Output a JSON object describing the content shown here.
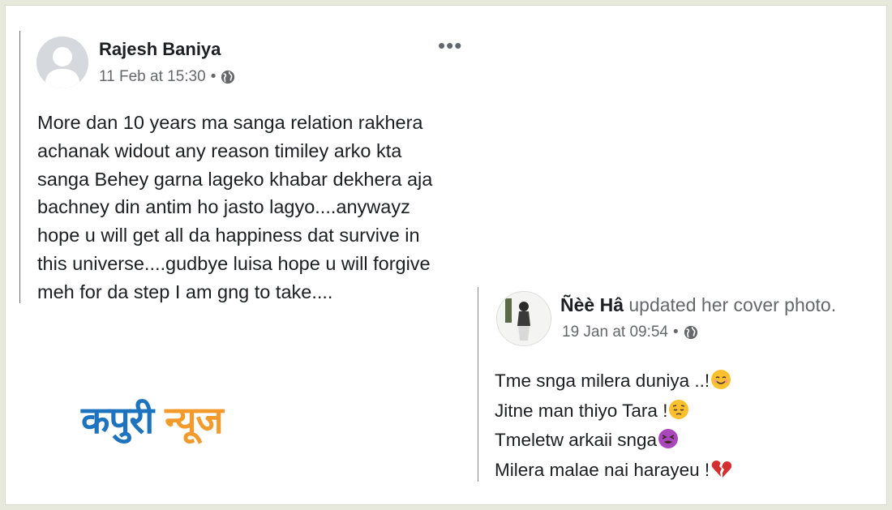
{
  "post1": {
    "author": "Rajesh Baniya",
    "timestamp": "11 Feb at 15:30",
    "separator": "•",
    "more_icon": "more-options-icon",
    "privacy_icon": "globe-icon",
    "lines": [
      "More dan 10 years ma sanga relation rakhera",
      "achanak widout any reason timiley arko kta",
      "sanga Behey garna lageko khabar dekhera aja",
      "bachney din antim ho jasto lagyo....anywayz",
      "hope u will get all da happiness dat survive in",
      "this universe....gudbye luisa hope u will forgive",
      "meh for da step I am gng to take...."
    ]
  },
  "logo": {
    "word1": "कपुरी",
    "word2": "न्यूज",
    "color1": "#1e73be",
    "color2": "#f39a2c"
  },
  "post2": {
    "author": "Ñèè Hâ",
    "action": " updated her cover photo.",
    "timestamp": "19 Jan at 09:54",
    "separator": "•",
    "privacy_icon": "globe-icon",
    "lines": [
      {
        "text": "Tme snga milera duniya ..!",
        "emoji": "smiling-face-icon"
      },
      {
        "text": "Jitne man thiyo Tara !",
        "emoji": "pensive-face-icon"
      },
      {
        "text": "Tmeletw arkaii snga",
        "emoji": "tired-face-icon"
      },
      {
        "text": "Milera malae nai harayeu !",
        "emoji": "broken-heart-icon"
      }
    ]
  },
  "colors": {
    "name": "#1c1e21",
    "meta": "#65676b",
    "frame_bg": "#e6e9dc"
  }
}
